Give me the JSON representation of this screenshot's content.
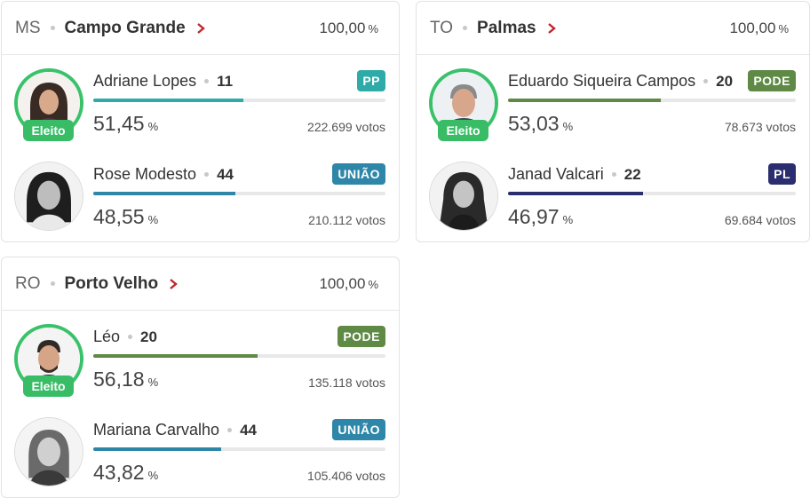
{
  "cards": [
    {
      "uf": "MS",
      "city": "Campo Grande",
      "total_pct": "100,00",
      "pct_symbol": "%",
      "candidates": [
        {
          "name": "Adriane Lopes",
          "number": "11",
          "party": "PP",
          "party_color": "#2eaaa8",
          "pct": "51,45",
          "share": 0.5145,
          "bar_color": "#2eaaa8",
          "votes": "222.699 votos",
          "elected": true,
          "elected_label": "Eleito",
          "avatar": "woman-dark-hair"
        },
        {
          "name": "Rose Modesto",
          "number": "44",
          "party": "UNIÃO",
          "party_color": "#2e86a8",
          "pct": "48,55",
          "share": 0.4855,
          "bar_color": "#2e86a8",
          "votes": "210.112 votos",
          "elected": false,
          "avatar": "woman-dark-hair"
        }
      ]
    },
    {
      "uf": "TO",
      "city": "Palmas",
      "total_pct": "100,00",
      "pct_symbol": "%",
      "candidates": [
        {
          "name": "Eduardo Siqueira Campos",
          "number": "20",
          "party": "PODE",
          "party_color": "#5e8a45",
          "pct": "53,03",
          "share": 0.5303,
          "bar_color": "#5e8a45",
          "votes": "78.673 votos",
          "elected": true,
          "elected_label": "Eleito",
          "avatar": "man-grey-hair"
        },
        {
          "name": "Janad Valcari",
          "number": "22",
          "party": "PL",
          "party_color": "#2b2e6e",
          "pct": "46,97",
          "share": 0.4697,
          "bar_color": "#2b2e6e",
          "votes": "69.684 votos",
          "elected": false,
          "avatar": "woman-long-hair"
        }
      ]
    },
    {
      "uf": "RO",
      "city": "Porto Velho",
      "total_pct": "100,00",
      "pct_symbol": "%",
      "candidates": [
        {
          "name": "Léo",
          "number": "20",
          "party": "PODE",
          "party_color": "#5e8a45",
          "pct": "56,18",
          "share": 0.5618,
          "bar_color": "#5e8a45",
          "votes": "135.118 votos",
          "elected": true,
          "elected_label": "Eleito",
          "avatar": "man-beard"
        },
        {
          "name": "Mariana Carvalho",
          "number": "44",
          "party": "UNIÃO",
          "party_color": "#2e86a8",
          "pct": "43,82",
          "share": 0.4382,
          "bar_color": "#2e86a8",
          "votes": "105.406 votos",
          "elected": false,
          "avatar": "woman-light-hair"
        }
      ]
    }
  ],
  "colors": {
    "chevron": "#c0262d",
    "elected_ring": "#3ac26a",
    "elected_badge": "#38bd66"
  }
}
